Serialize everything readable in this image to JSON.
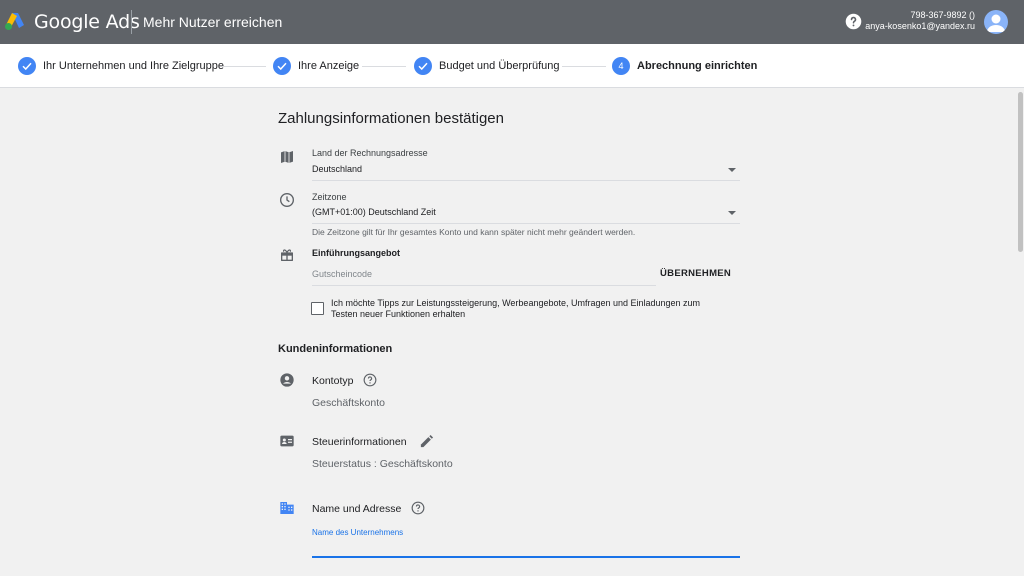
{
  "header": {
    "product_name": "Google Ads",
    "campaign_title": "Mehr Nutzer erreichen",
    "phone": "798-367-9892 ()",
    "email": "anya-kosenko1@yandex.ru"
  },
  "stepper": {
    "steps": [
      {
        "label": "Ihr Unternehmen und Ihre Zielgruppe",
        "state": "done"
      },
      {
        "label": "Ihre Anzeige",
        "state": "done"
      },
      {
        "label": "Budget und Überprüfung",
        "state": "done"
      },
      {
        "label": "Abrechnung einrichten",
        "state": "active",
        "number": "4"
      }
    ]
  },
  "payment": {
    "title": "Zahlungsinformationen bestätigen",
    "country": {
      "label": "Land der Rechnungsadresse",
      "value": "Deutschland"
    },
    "timezone": {
      "label": "Zeitzone",
      "value": "(GMT+01:00) Deutschland Zeit",
      "hint": "Die Zeitzone gilt für Ihr gesamtes Konto und kann später nicht mehr geändert werden."
    },
    "promo": {
      "label": "Einführungsangebot",
      "placeholder": "Gutscheincode",
      "apply_label": "ÜBERNEHMEN"
    },
    "tips_checkbox": {
      "text": "Ich möchte Tipps zur Leistungssteigerung, Werbeangebote, Umfragen und Einladungen zum Testen neuer Funktionen erhalten",
      "checked": false
    }
  },
  "customer": {
    "title": "Kundeninformationen",
    "account_type": {
      "label": "Kontotyp",
      "value": "Geschäftskonto"
    },
    "tax": {
      "label": "Steuerinformationen",
      "value": "Steuerstatus : Geschäftskonto"
    },
    "name_address": {
      "label": "Name und Adresse",
      "input_label": "Name des Unternehmens"
    }
  },
  "colors": {
    "header_bg": "#5f6368",
    "accent": "#4285f4",
    "focus_blue": "#1a73e8",
    "background": "#f1f1f1"
  },
  "icons": {
    "logo": "google-ads-logo",
    "help": "help-icon",
    "avatar": "avatar",
    "map": "map-icon",
    "clock": "clock-icon",
    "gift": "gift-icon",
    "account_circle": "account-circle-icon",
    "id_card": "id-card-icon",
    "building": "building-icon",
    "edit": "pencil-icon",
    "help_outline": "help-outline-icon"
  }
}
